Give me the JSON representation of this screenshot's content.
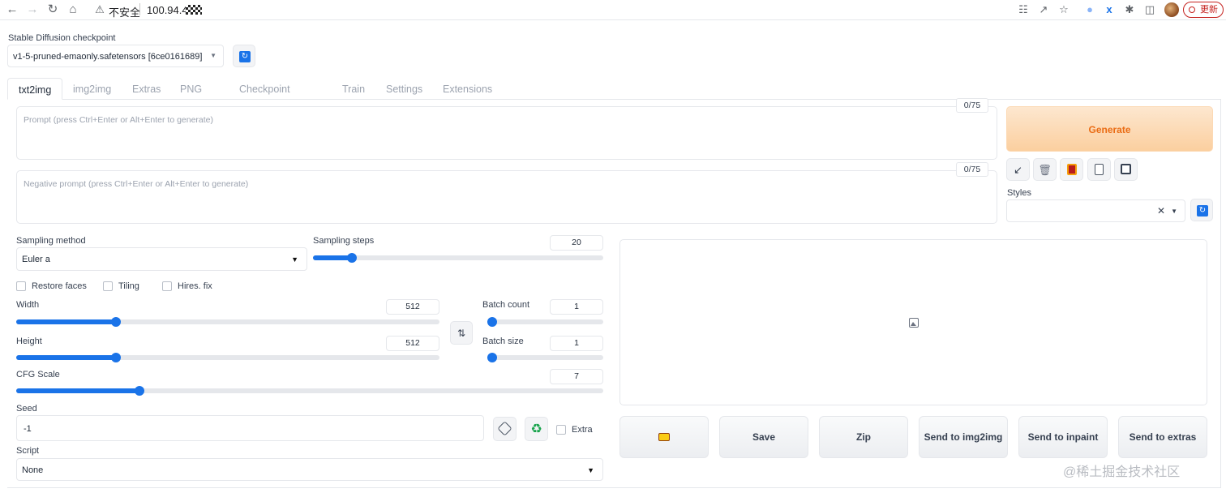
{
  "browser": {
    "security_label": "不安全",
    "url": "100.94.4.",
    "update_label": "更新"
  },
  "checkpoint": {
    "label": "Stable Diffusion checkpoint",
    "value": "v1-5-pruned-emaonly.safetensors [6ce0161689]"
  },
  "tabs": [
    "txt2img",
    "img2img",
    "Extras",
    "PNG Info",
    "Checkpoint Merger",
    "Train",
    "Settings",
    "Extensions"
  ],
  "prompt": {
    "placeholder": "Prompt (press Ctrl+Enter or Alt+Enter to generate)",
    "counter": "0/75"
  },
  "negative_prompt": {
    "placeholder": "Negative prompt (press Ctrl+Enter or Alt+Enter to generate)",
    "counter": "0/75"
  },
  "generate_label": "Generate",
  "tool_icons": [
    "arrow-icon",
    "trash-icon",
    "extra-networks-icon",
    "clipboard-icon",
    "save-style-icon"
  ],
  "styles": {
    "label": "Styles",
    "value": ""
  },
  "sampling": {
    "method_label": "Sampling method",
    "method_value": "Euler a",
    "steps_label": "Sampling steps",
    "steps_value": "20",
    "steps_fraction": 0.135
  },
  "checkboxes": {
    "restore_faces": "Restore faces",
    "tiling": "Tiling",
    "hires_fix": "Hires. fix",
    "extra": "Extra"
  },
  "width": {
    "label": "Width",
    "value": "512",
    "fraction": 0.235
  },
  "height": {
    "label": "Height",
    "value": "512",
    "fraction": 0.235
  },
  "batch_count": {
    "label": "Batch count",
    "value": "1",
    "fraction": 0.0
  },
  "batch_size": {
    "label": "Batch size",
    "value": "1",
    "fraction": 0.0
  },
  "cfg": {
    "label": "CFG Scale",
    "value": "7",
    "fraction": 0.21
  },
  "seed": {
    "label": "Seed",
    "value": "-1"
  },
  "script": {
    "label": "Script",
    "value": "None"
  },
  "output_buttons": [
    "Save",
    "Zip",
    "Send to img2img",
    "Send to inpaint",
    "Send to extras"
  ],
  "watermark": "@稀土掘金技术社区",
  "colors": {
    "accent": "#1a73e8",
    "generate_text": "#ea6c14",
    "generate_bg": "#fbcf9f"
  }
}
